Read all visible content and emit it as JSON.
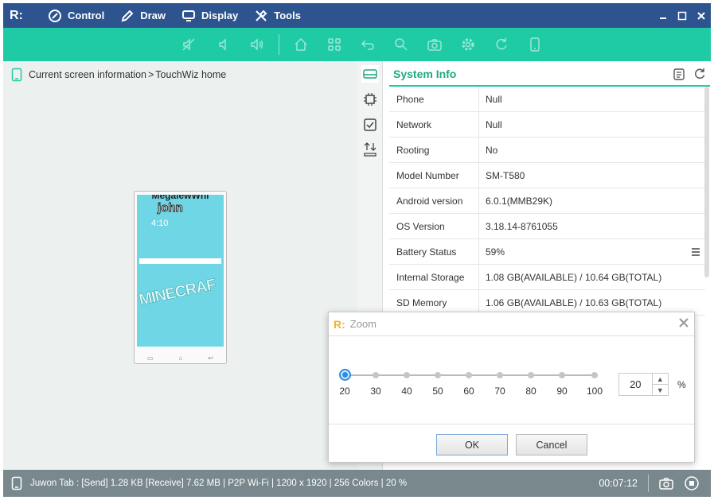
{
  "app": {
    "logo": "R:",
    "menu": [
      {
        "label": "Control",
        "icon": "control-icon"
      },
      {
        "label": "Draw",
        "icon": "pen-icon"
      },
      {
        "label": "Display",
        "icon": "monitor-icon"
      },
      {
        "label": "Tools",
        "icon": "tools-icon"
      }
    ]
  },
  "toolbar": {
    "icons": [
      "mute-icon",
      "volume-down-icon",
      "volume-up-icon",
      "home-icon",
      "apps-icon",
      "back-icon",
      "search-icon",
      "camera-icon",
      "settings-icon",
      "refresh-icon",
      "device-icon"
    ]
  },
  "breadcrumb": {
    "section": "Current screen information",
    "separator": ">",
    "current": "TouchWiz home"
  },
  "phone": {
    "line1": "MegalewWhi",
    "line2": "john",
    "time": "4:10",
    "graffiti": "MINECRAF"
  },
  "panel": {
    "title": "System Info",
    "rows": [
      {
        "key": "Phone",
        "value": "Null"
      },
      {
        "key": "Network",
        "value": "Null"
      },
      {
        "key": "Rooting",
        "value": "No"
      },
      {
        "key": "Model Number",
        "value": "SM-T580"
      },
      {
        "key": "Android version",
        "value": "6.0.1(MMB29K)"
      },
      {
        "key": "OS Version",
        "value": "3.18.14-8761055"
      },
      {
        "key": "Battery Status",
        "value": "59%"
      },
      {
        "key": "Internal Storage",
        "value": "1.08 GB(AVAILABLE) / 10.64 GB(TOTAL)"
      },
      {
        "key": "SD Memory",
        "value": "1.06 GB(AVAILABLE) / 10.63 GB(TOTAL)"
      }
    ]
  },
  "status": {
    "info": "Juwon Tab : [Send] 1.28 KB  [Receive] 7.62 MB | P2P Wi-Fi | 1200 x 1920 | 256 Colors | 20 %",
    "time": "00:07:12"
  },
  "zoom_dialog": {
    "logo": "R:",
    "title": "Zoom",
    "ticks": [
      "20",
      "30",
      "40",
      "50",
      "60",
      "70",
      "80",
      "90",
      "100"
    ],
    "value": "20",
    "unit": "%",
    "ok_label": "OK",
    "cancel_label": "Cancel"
  }
}
